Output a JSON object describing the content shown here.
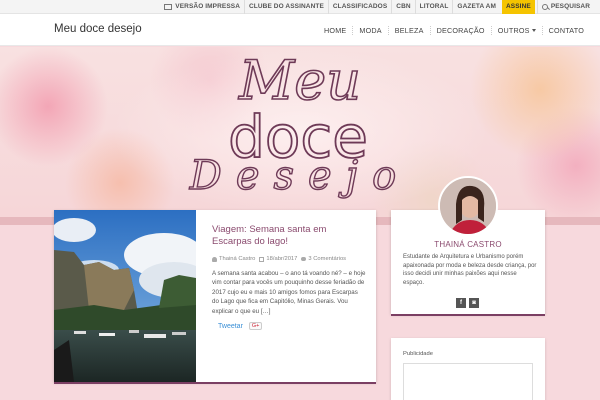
{
  "utility": {
    "items": [
      "VERSÃO IMPRESSA",
      "CLUBE DO ASSINANTE",
      "CLASSIFICADOS",
      "CBN",
      "LITORAL",
      "GAZETA AM"
    ],
    "subscribe": "ASSINE",
    "search": "PESQUISAR"
  },
  "header": {
    "site_title": "Meu doce desejo",
    "menu": [
      "HOME",
      "MODA",
      "BELEZA",
      "DECORAÇÃO",
      "OUTROS",
      "CONTATO"
    ]
  },
  "banner": {
    "logo_line1": "Meu",
    "logo_line2": "doce",
    "logo_line3": "Desejo"
  },
  "post": {
    "title": "Viagem: Semana santa em Escarpas do lago!",
    "author": "Thainá Castro",
    "date": "18/abr/2017",
    "comments": "3 Comentários",
    "excerpt": "A semana santa acabou – o ano tá voando né? – e hoje vim contar para vocês um pouquinho desse feriadão de 2017 cujo eu e mais 10 amigos fomos para Escarpas do Lago que fica em Capitólio, Minas Gerais. Vou explicar o que eu […]",
    "tweet": "Tweetar",
    "gplus": "G+"
  },
  "profile": {
    "name": "THAINÁ CASTRO",
    "bio": "Estudante de Arquitetura e Urbanismo porém apaixonada por moda e beleza desde criança, por isso decidi unir minhas paixões aqui nesse espaço.",
    "social": [
      "f",
      "◙"
    ]
  },
  "ad": {
    "label": "Publicidade"
  },
  "colors": {
    "accent": "#8a4a6e",
    "subscribe_bg": "#f5c400",
    "banner_bg": "#f6d6d8"
  }
}
